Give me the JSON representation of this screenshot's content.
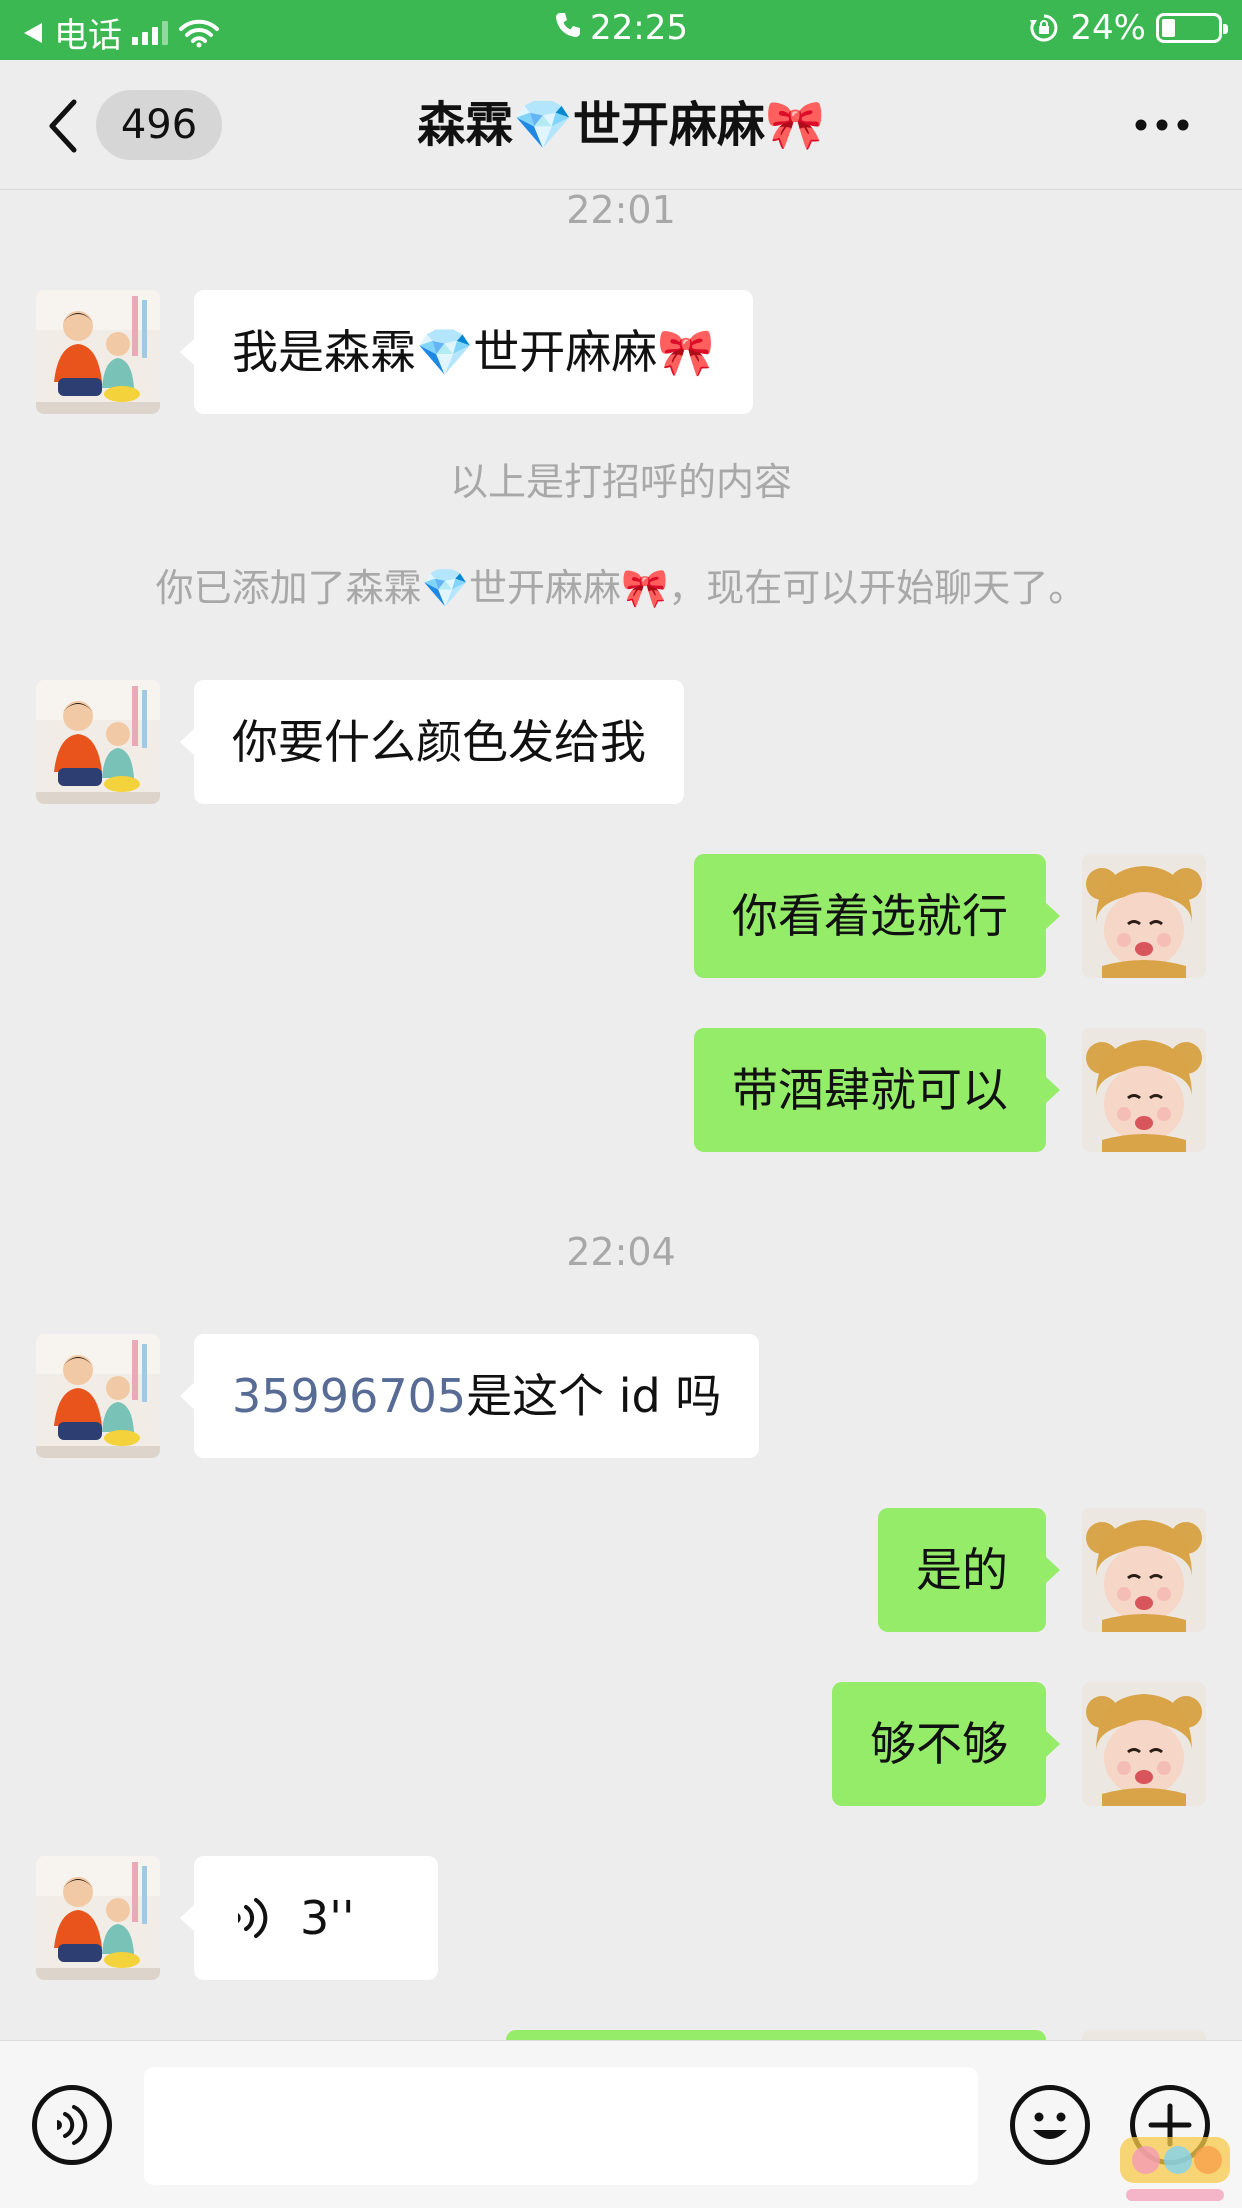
{
  "status_bar": {
    "carrier": "电话",
    "time": "22:25",
    "battery_percent": "24%",
    "battery_level": 0.24
  },
  "nav": {
    "unread_count": "496",
    "title": "森霖💎世开麻麻🎀"
  },
  "chat": {
    "time_1": "22:01",
    "greeting": "我是森霖💎世开麻麻🎀",
    "sys_hint": "以上是打招呼的内容",
    "sys_added": "你已添加了森霖💎世开麻麻🎀，现在可以开始聊天了。",
    "msg_1": "你要什么颜色发给我",
    "msg_2": "你看着选就行",
    "msg_3": "带酒肆就可以",
    "time_2": "22:04",
    "msg_4_id": "35996705",
    "msg_4_text": "是这个 id 吗",
    "msg_5": "是的",
    "msg_6": "够不够",
    "voice_duration": "3''"
  },
  "input_bar": {
    "value": ""
  },
  "colors": {
    "status_green": "#3cb853",
    "bubble_out": "#95ec69",
    "bubble_in": "#ffffff",
    "link": "#576b95",
    "background": "#ededed"
  }
}
